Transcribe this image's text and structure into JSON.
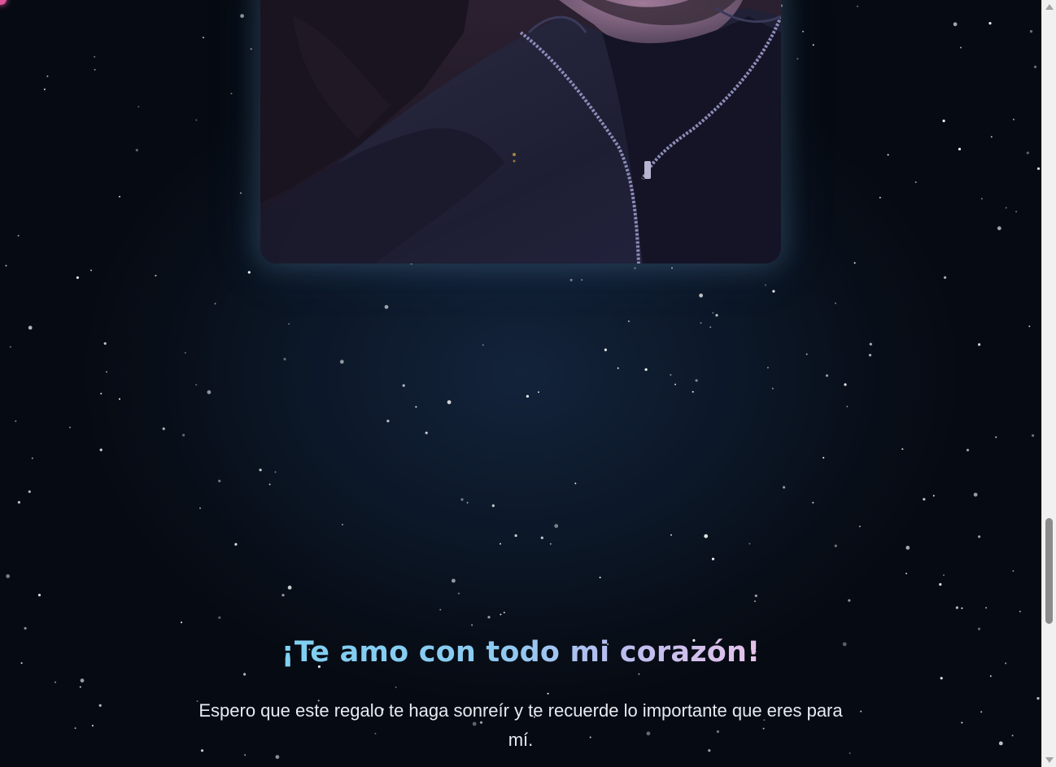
{
  "main": {
    "headline": "¡Te amo con todo mi corazón!",
    "message": "Espero que este regalo te haga sonreír y te recuerde lo importante que eres para mí."
  },
  "colors": {
    "background": "#0a1220",
    "headline_gradient_start": "#7fd0f2",
    "headline_gradient_end": "#e6c2e8",
    "message_text": "#e6ebf2",
    "photo_glow": "#78aad2",
    "accent_pink": "#e0559a"
  },
  "scrollbar": {
    "position_fraction": 0.74
  }
}
